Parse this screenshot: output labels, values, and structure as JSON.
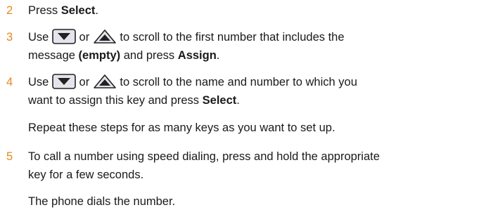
{
  "steps": [
    {
      "number": "2",
      "pre": "Press ",
      "key": "Select",
      "post": "."
    },
    {
      "number": "3",
      "use": "Use ",
      "or": " or ",
      "mid": " to scroll to the first number that includes the",
      "line2_pre": "message ",
      "key1": "(empty)",
      "line2_mid": " and press ",
      "key2": "Assign",
      "line2_post": "."
    },
    {
      "number": "4",
      "use": "Use ",
      "or": " or ",
      "mid": " to scroll to the name and number to which you",
      "line2_pre": "want to assign this key and press ",
      "key": "Select",
      "line2_post": "."
    },
    {
      "number": "5",
      "line1": "To call a number using speed dialing, press and hold the appropriate",
      "line2": "key for a few seconds."
    }
  ],
  "repeat_note": "Repeat these steps for as many keys as you want to set up.",
  "result_note": "The phone dials the number.",
  "icons": {
    "down": "scroll-down-key-icon",
    "up": "scroll-up-key-icon"
  },
  "colors": {
    "step_number": "#e08a1e",
    "text": "#1a1a1a"
  }
}
